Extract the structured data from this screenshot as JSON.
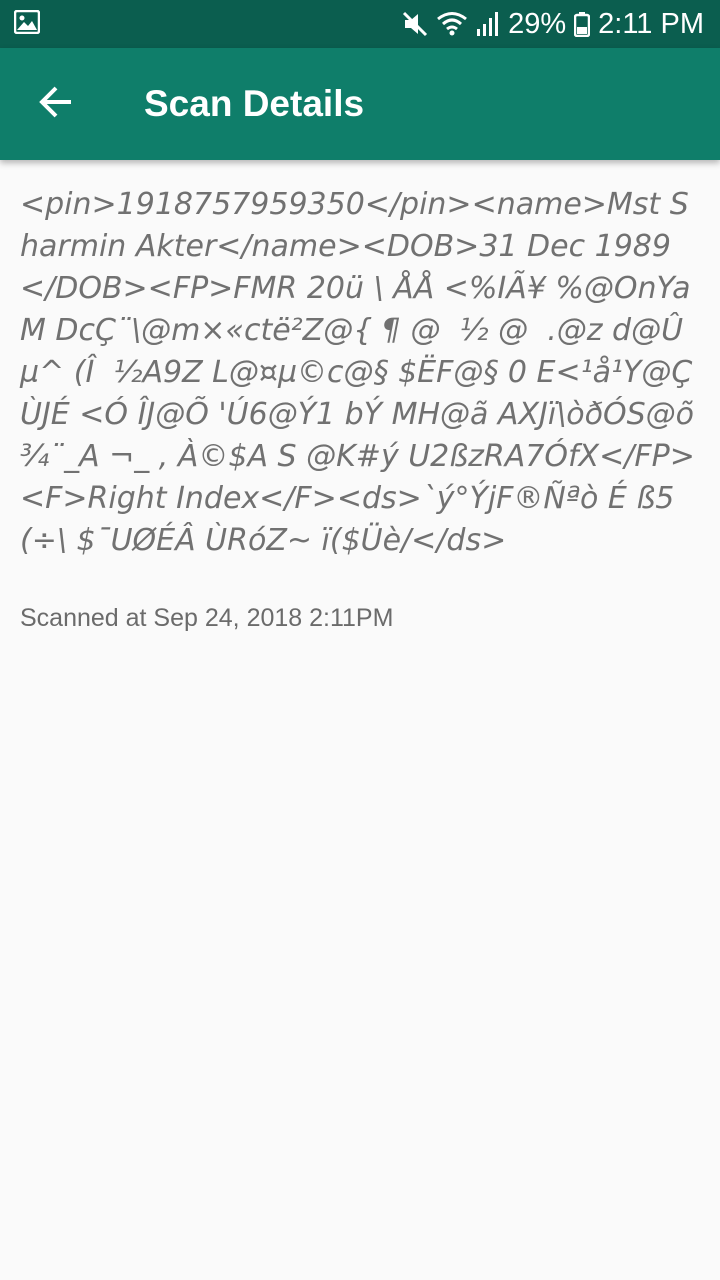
{
  "status_bar": {
    "battery_percent": "29%",
    "time": "2:11 PM",
    "icons": [
      "image-icon",
      "mute-icon",
      "wifi-icon",
      "signal-icon",
      "battery-icon"
    ]
  },
  "app_bar": {
    "back_icon": "arrow-back-icon",
    "title": "Scan Details",
    "color": "#0f7e6a"
  },
  "scan": {
    "content": "<pin>1918757959350</pin><name>Mst Sharmin Akter</name><DOB>31 Dec 1989</DOB><FP>FMR 20ü \\ ÅÅ <%IÃ¥ %@OnYaM DcÇ¨\\@m×«ctë²Z@{ ¶ @  ½ @  .@z d@Ûµ^ (Î  ½A9Z L@¤µ©c@§ $ËF@§ 0 E<¹å¹Y@Ç ÙJÉ <Ó ÎJ@Õ 'Ú6@Ý1 bÝ MH@ã AXJï\\òðÓS@õ¾¨_A ¬_ , À©$A S @K#ý U2ßzRA7ÓfX</FP><F>Right Index</F><ds>`ý°ÝjF®Ñªò É ß5(÷\\ $¯UØÉÂ ÙRóZ~ ï($Üè/</ds>",
    "timestamp": "Scanned at Sep 24, 2018 2:11PM"
  }
}
